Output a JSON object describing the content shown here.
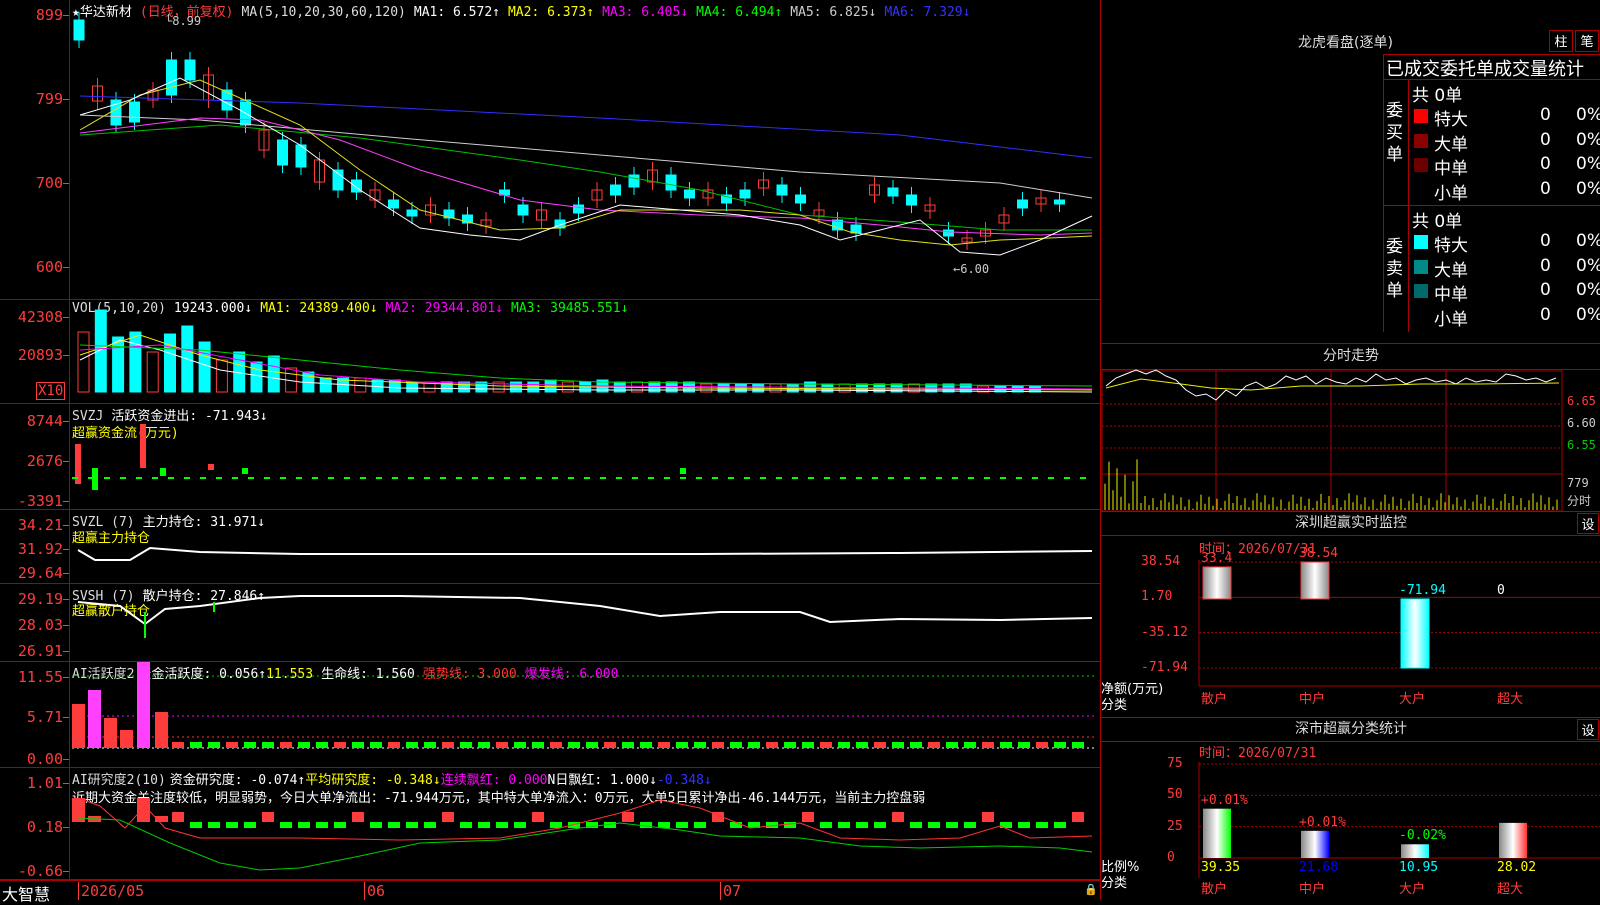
{
  "stock": {
    "name": "华达新材",
    "mode": "(日线，前复权)",
    "ma_label": "MA(5,10,20,30,60,120)",
    "ma1": "MA1: 6.572↑",
    "ma2": "MA2: 6.373↑",
    "ma3": "MA3: 6.405↓",
    "ma4": "MA4: 6.494↑",
    "ma5": "MA5: 6.825↓",
    "ma6": "MA6: 7.329↓",
    "high_note": "8.99",
    "low_note": "←6.00"
  },
  "kline_axis": [
    "899",
    "799",
    "700",
    "600"
  ],
  "vol": {
    "label": "VOL(5,10,20)",
    "v": "19243.000↓",
    "ma1": "MA1: 24389.400↓",
    "ma2": "MA2: 29344.801↓",
    "ma3": "MA3: 39485.551↓",
    "axis": [
      "42308",
      "20893",
      "X10"
    ]
  },
  "svzj": {
    "label": "SVZJ",
    "t1": "活跃资金进出: -71.943↓",
    "t2": "超赢资金流(万元)",
    "axis": [
      "8744",
      "2676",
      "-3391"
    ]
  },
  "svzl": {
    "label": "SVZL (7)",
    "t1": "主力持仓: 31.971↓",
    "t2": "超赢主力持仓",
    "axis": [
      "34.21",
      "31.92",
      "29.64"
    ]
  },
  "svsh": {
    "label": "SVSH (7)",
    "t1": "散户持仓: 27.846↑",
    "t2": "超赢散户持仓",
    "axis": [
      "29.19",
      "28.03",
      "26.91"
    ]
  },
  "ai1": {
    "label": "AI活跃度2",
    "t1": "资金活跃度: 0.056↑",
    "t2": "11.553",
    "t3": "生命线: 1.560",
    "t4": "强势线: 3.000",
    "t5": "爆发线: 6.000",
    "axis": [
      "11.55",
      "5.71",
      "0.00"
    ]
  },
  "ai2": {
    "label": "AI研究度2(10)",
    "t1": "资金研究度: -0.074↑",
    "t2": "平均研究度: -0.348↓",
    "t3": "连续飘红: 0.000",
    "t4": "N日飘红: 1.000↓",
    "t5": "-0.348↓",
    "desc": "近期大资金关注度较低，明显弱势，今日大单净流出：-71.944万元，其中特大单净流入：0万元，大单5日累计净出-46.144万元，当前主力控盘弱",
    "axis": [
      "1.01",
      "0.18",
      "-0.66"
    ]
  },
  "bottom": {
    "brand": "大智慧",
    "dates": [
      "2026/05",
      "06",
      "07"
    ]
  },
  "lhb": {
    "title": "龙虎看盘(逐单)",
    "btn1": "柱",
    "btn2": "笔",
    "subtitle": "已成交委托单成交量统计",
    "buy": "委买单",
    "sell": "委卖单",
    "buy_total": "共 0单",
    "sell_total": "共 0单",
    "rows_buy": [
      {
        "name": "特大",
        "v": "0",
        "p": "0%",
        "c": "#ff0000"
      },
      {
        "name": "大单",
        "v": "0",
        "p": "0%",
        "c": "#8b0000"
      },
      {
        "name": "中单",
        "v": "0",
        "p": "0%",
        "c": "#6a0000"
      },
      {
        "name": "小单",
        "v": "0",
        "p": "0%",
        "c": ""
      }
    ],
    "rows_sell": [
      {
        "name": "特大",
        "v": "0",
        "p": "0%",
        "c": "#00ffff"
      },
      {
        "name": "大单",
        "v": "0",
        "p": "0%",
        "c": "#008b8b"
      },
      {
        "name": "中单",
        "v": "0",
        "p": "0%",
        "c": "#006a6a"
      },
      {
        "name": "小单",
        "v": "0",
        "p": "0%",
        "c": ""
      }
    ]
  },
  "fs": {
    "title": "分时走势",
    "axis": [
      "6.65",
      "6.60",
      "6.55"
    ],
    "vol_axis": [
      "779",
      "分时"
    ]
  },
  "monitor": {
    "title": "深圳超赢实时监控",
    "btn": "设",
    "time": "时间：2026/07/31",
    "axis": [
      "38.54",
      "1.70",
      "-35.12",
      "-71.94"
    ],
    "ylab1": "净额(万元)",
    "ylab2": "分类",
    "cats": [
      "散户",
      "中户",
      "大户",
      "超大"
    ],
    "values": [
      "33.4",
      "38.54",
      "-71.94",
      "0"
    ],
    "nums": [
      33.4,
      38.54,
      -71.94,
      0
    ]
  },
  "stat": {
    "title": "深市超赢分类统计",
    "btn": "设",
    "time": "时间：2026/07/31",
    "axis": [
      "75",
      "50",
      "25",
      "0"
    ],
    "ylab1": "比例%",
    "ylab2": "分类",
    "cats": [
      "散户",
      "中户",
      "大户",
      "超大"
    ],
    "pct": [
      "+0.01%",
      "+0.01%",
      "-0.02%",
      ""
    ],
    "vals": [
      "39.35",
      "21.68",
      "10.95",
      "28.02"
    ],
    "nums": [
      39.35,
      21.68,
      10.95,
      28.02
    ]
  }
}
